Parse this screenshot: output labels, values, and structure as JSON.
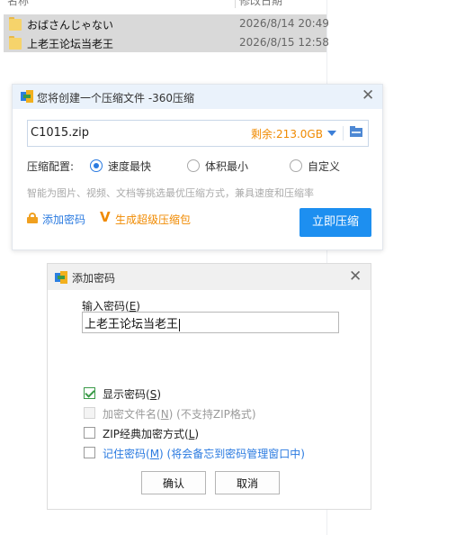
{
  "explorer": {
    "column_name": "名称",
    "column_date": "修改日期",
    "files": [
      {
        "name": "おばさんじゃない",
        "date": "2026/8/14 20:49"
      },
      {
        "name": "上老王论坛当老王",
        "date": "2026/8/15 12:58"
      }
    ]
  },
  "compress_dialog": {
    "title": "您将创建一个压缩文件 -360压缩",
    "filename": "C1015.zip",
    "free_space": "剩余:213.0GB",
    "config_label": "压缩配置:",
    "options": [
      {
        "label": "速度最快",
        "selected": true
      },
      {
        "label": "体积最小",
        "selected": false
      },
      {
        "label": "自定义",
        "selected": false
      }
    ],
    "hint": "智能为图片、视频、文档等挑选最优压缩方式，兼具速度和压缩率",
    "add_password_link": "添加密码",
    "super_package_link": "生成超级压缩包",
    "compress_button": "立即压缩",
    "colors": {
      "accent": "#1d8ff0",
      "warning": "#f08a00",
      "title_bg": "#eaf2fb"
    }
  },
  "password_dialog": {
    "title": "添加密码",
    "input_label_prefix": "输入密码(",
    "input_label_key": "E",
    "input_label_suffix": ")",
    "password_value": "上老王论坛当老王",
    "checkboxes": [
      {
        "prefix": "显示密码(",
        "key": "S",
        "suffix": ")",
        "checked": true,
        "enabled": true
      },
      {
        "prefix": "加密文件名(",
        "key": "N",
        "suffix": ") (不支持ZIP格式)",
        "checked": false,
        "enabled": false
      },
      {
        "prefix": "ZIP经典加密方式(",
        "key": "L",
        "suffix": ")",
        "checked": false,
        "enabled": true
      },
      {
        "prefix": "记住密码(",
        "key": "M",
        "suffix": ") (将会备忘到密码管理窗口中)",
        "checked": false,
        "enabled": true
      }
    ],
    "ok_button": "确认",
    "cancel_button": "取消"
  }
}
